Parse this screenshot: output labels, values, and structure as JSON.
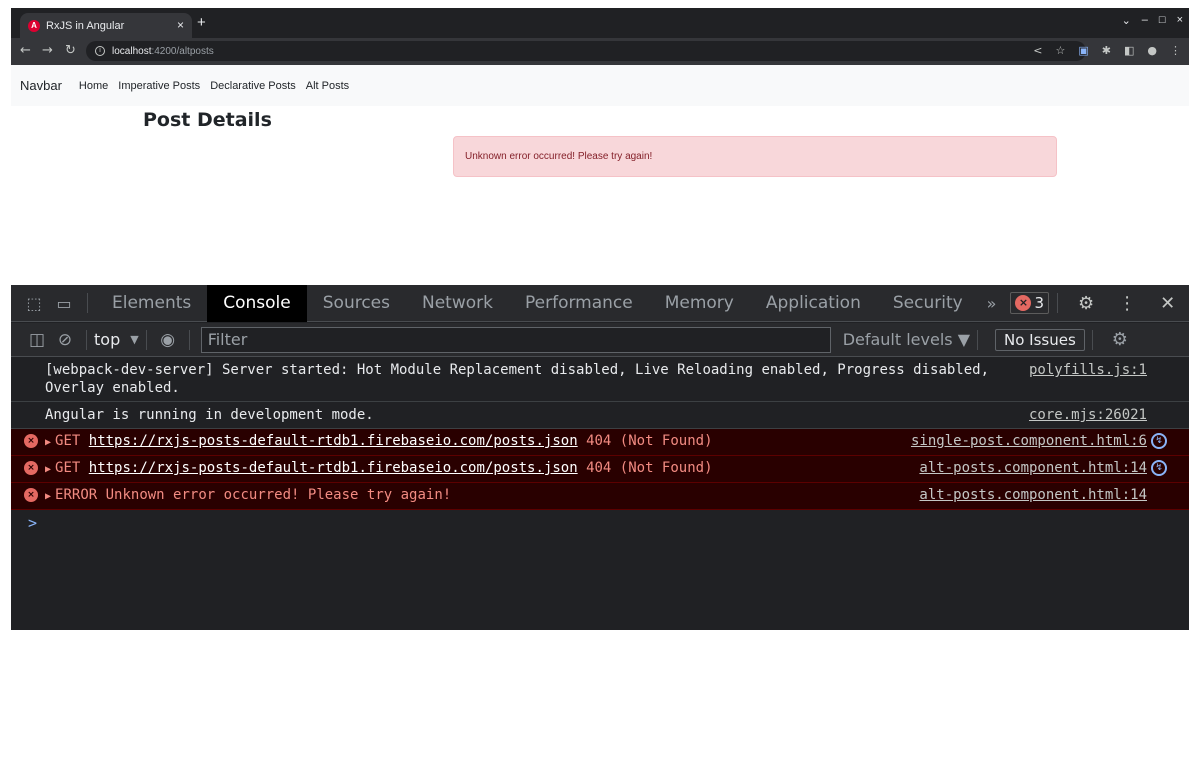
{
  "browser": {
    "tab_title": "RxJS in Angular",
    "tab_close": "×",
    "new_tab": "+",
    "url_host": "localhost",
    "url_rest": ":4200/altposts",
    "win_min": "⌄",
    "win_restore": "–",
    "win_max": "□",
    "win_close": "×"
  },
  "navbar": {
    "brand": "Navbar",
    "links": [
      "Home",
      "Imperative Posts",
      "Declarative Posts",
      "Alt Posts"
    ]
  },
  "content": {
    "title": "Post Details",
    "alert": "Unknown error occurred! Please try again!"
  },
  "devtools": {
    "tabs": [
      "Elements",
      "Console",
      "Sources",
      "Network",
      "Performance",
      "Memory",
      "Application",
      "Security"
    ],
    "more": "»",
    "error_count": "3",
    "context": "top",
    "filter_placeholder": "Filter",
    "levels": "Default levels ▼",
    "issues": "No Issues"
  },
  "console": {
    "messages": [
      {
        "text": "[webpack-dev-server] Server started: Hot Module Replacement disabled, Live Reloading enabled, Progress disabled, Overlay enabled.",
        "source": "polyfills.js:1"
      },
      {
        "text": "Angular is running in development mode.",
        "source": "core.mjs:26021"
      },
      {
        "method": "GET",
        "url": "https://rxjs-posts-default-rtdb1.firebaseio.com/posts.json",
        "status": "404 (Not Found)",
        "source": "single-post.component.html:6"
      },
      {
        "method": "GET",
        "url": "https://rxjs-posts-default-rtdb1.firebaseio.com/posts.json",
        "status": "404 (Not Found)",
        "source": "alt-posts.component.html:14"
      },
      {
        "text": "ERROR Unknown error occurred! Please try again!",
        "source": "alt-posts.component.html:14"
      }
    ],
    "prompt": ">"
  }
}
